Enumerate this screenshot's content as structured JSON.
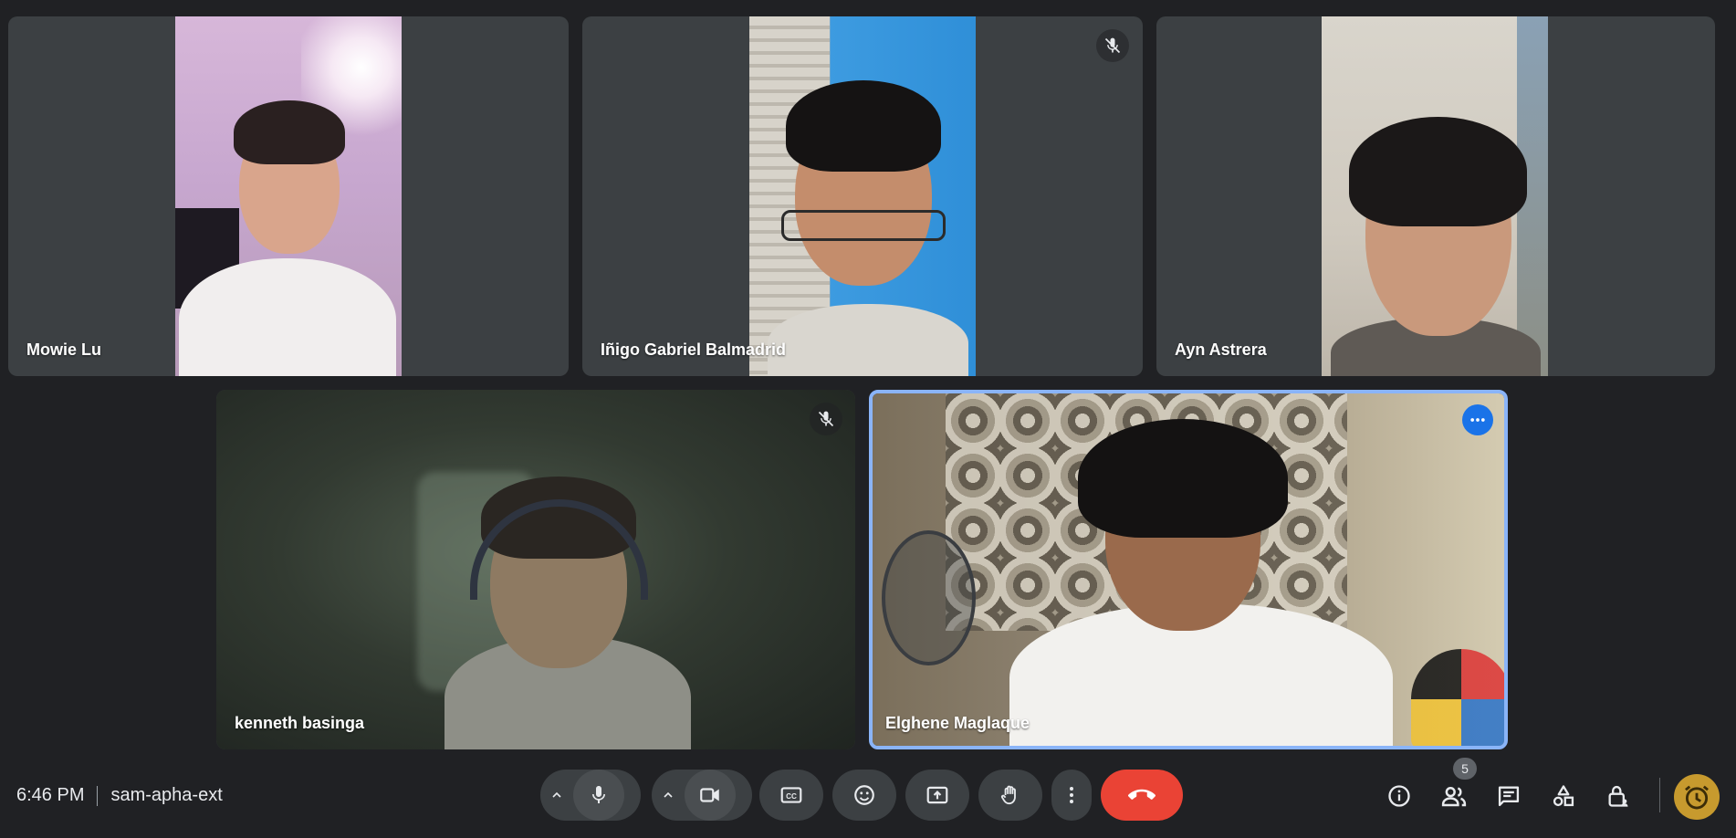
{
  "participants": [
    {
      "name": "Mowie Lu",
      "muted": false
    },
    {
      "name": "Iñigo Gabriel Balmadrid",
      "muted": true
    },
    {
      "name": "Ayn Astrera",
      "muted": false
    },
    {
      "name": "kenneth basinga",
      "muted": true
    },
    {
      "name": "Elghene Maglaque",
      "muted": false,
      "active_speaker": true
    }
  ],
  "status": {
    "time": "6:46 PM",
    "meeting_code": "sam-apha-ext"
  },
  "controls": {
    "mic_options_icon": "chevron-up-icon",
    "mic_icon": "mic-icon",
    "camera_options_icon": "chevron-up-icon",
    "camera_icon": "videocam-icon",
    "captions_icon": "closed-captions-icon",
    "reactions_icon": "emoji-icon",
    "present_icon": "present-screen-icon",
    "raise_hand_icon": "hand-icon",
    "more_options_icon": "more-vert-icon",
    "end_call_icon": "call-end-icon"
  },
  "right_panel": {
    "info_icon": "info-icon",
    "people_icon": "people-icon",
    "people_count": "5",
    "chat_icon": "chat-icon",
    "activities_icon": "activities-icon",
    "host_controls_icon": "lock-person-icon",
    "host_avatar_icon": "timer-avatar-icon"
  },
  "colors": {
    "background": "#202124",
    "tile": "#3c4043",
    "active_border": "#8ab4f8",
    "end_call": "#ea4335",
    "accent_blue": "#1a73e8"
  }
}
